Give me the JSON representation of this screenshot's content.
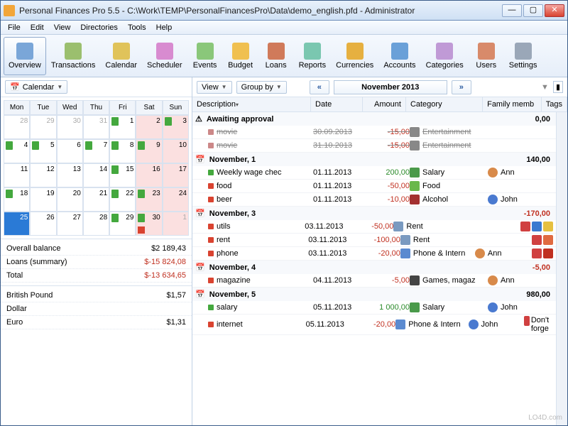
{
  "window": {
    "title": "Personal Finances Pro 5.5 - C:\\Work\\TEMP\\PersonalFinancesPro\\Data\\demo_english.pfd - Administrator"
  },
  "menu": [
    "File",
    "Edit",
    "View",
    "Directories",
    "Tools",
    "Help"
  ],
  "toolbar": [
    {
      "label": "Overview",
      "color": "#7aa6d8",
      "active": true
    },
    {
      "label": "Transactions",
      "color": "#9bbf6e"
    },
    {
      "label": "Calendar",
      "color": "#e0c35a"
    },
    {
      "label": "Scheduler",
      "color": "#d88bd0"
    },
    {
      "label": "Events",
      "color": "#8ac77a"
    },
    {
      "label": "Budget",
      "color": "#f0c050"
    },
    {
      "label": "Loans",
      "color": "#d07a5a"
    },
    {
      "label": "Reports",
      "color": "#7ac7b0"
    },
    {
      "label": "Currencies",
      "color": "#e6b040"
    },
    {
      "label": "Accounts",
      "color": "#6aa0d8"
    },
    {
      "label": "Categories",
      "color": "#c09ad6"
    },
    {
      "label": "Users",
      "color": "#d88a6a"
    },
    {
      "label": "Settings",
      "color": "#9aa7b8"
    }
  ],
  "left_toolbar": {
    "calendar": "Calendar"
  },
  "right_toolbar": {
    "view": "View",
    "group_by": "Group by",
    "month": "November 2013"
  },
  "days": [
    "Mon",
    "Tue",
    "Wed",
    "Thu",
    "Fri",
    "Sat",
    "Sun"
  ],
  "calendar_cells": [
    {
      "n": "28",
      "other": true
    },
    {
      "n": "29",
      "other": true
    },
    {
      "n": "30",
      "other": true
    },
    {
      "n": "31",
      "other": true
    },
    {
      "n": "1",
      "mark": true
    },
    {
      "n": "2",
      "wknd": true
    },
    {
      "n": "3",
      "wknd": true,
      "mark": true
    },
    {
      "n": "4",
      "mark": true
    },
    {
      "n": "5",
      "mark": true
    },
    {
      "n": "6"
    },
    {
      "n": "7",
      "mark": true
    },
    {
      "n": "8",
      "mark": true
    },
    {
      "n": "9",
      "wknd": true,
      "mark": true
    },
    {
      "n": "10",
      "wknd": true
    },
    {
      "n": "11"
    },
    {
      "n": "12"
    },
    {
      "n": "13"
    },
    {
      "n": "14"
    },
    {
      "n": "15",
      "mark": true
    },
    {
      "n": "16",
      "wknd": true
    },
    {
      "n": "17",
      "wknd": true
    },
    {
      "n": "18",
      "mark": true
    },
    {
      "n": "19"
    },
    {
      "n": "20"
    },
    {
      "n": "21"
    },
    {
      "n": "22",
      "mark": true
    },
    {
      "n": "23",
      "wknd": true,
      "mark": true
    },
    {
      "n": "24",
      "wknd": true
    },
    {
      "n": "25",
      "sel": true
    },
    {
      "n": "26"
    },
    {
      "n": "27"
    },
    {
      "n": "28"
    },
    {
      "n": "29",
      "mark": true
    },
    {
      "n": "30",
      "wknd": true,
      "mark": true,
      "note": true
    },
    {
      "n": "1",
      "wknd": true,
      "other": true
    }
  ],
  "summary": {
    "balance": {
      "label": "Overall balance",
      "value": "$2 189,43"
    },
    "loans": {
      "label": "Loans (summary)",
      "value": "$-15 824,08"
    },
    "total": {
      "label": "Total",
      "value": "$-13 634,65"
    }
  },
  "rates": [
    {
      "label": "British Pound",
      "value": "$1,57"
    },
    {
      "label": "Dollar",
      "value": ""
    },
    {
      "label": "Euro",
      "value": "$1,31"
    }
  ],
  "columns": {
    "desc": "Description",
    "date": "Date",
    "amount": "Amount",
    "category": "Category",
    "family": "Family memb",
    "tags": "Tags"
  },
  "groups": [
    {
      "title": "Awaiting approval",
      "amount": "0,00",
      "warn": true,
      "rows": [
        {
          "desc": "movie",
          "date": "30.09.2013",
          "amount": "-15,00",
          "neg": true,
          "cat": "Entertainment",
          "catc": "#888",
          "striked": true
        },
        {
          "desc": "movie",
          "date": "31.10.2013",
          "amount": "-15,00",
          "neg": true,
          "cat": "Entertainment",
          "catc": "#888",
          "striked": true
        }
      ]
    },
    {
      "title": "November, 1",
      "amount": "140,00",
      "rows": [
        {
          "desc": "Weekly wage chec",
          "date": "01.11.2013",
          "amount": "200,00",
          "pos": true,
          "cat": "Salary",
          "catc": "#4a9a4a",
          "fam": "Ann",
          "famc": "#d88a4a",
          "dot": "g"
        },
        {
          "desc": "food",
          "date": "01.11.2013",
          "amount": "-50,00",
          "neg": true,
          "cat": "Food",
          "catc": "#6ab84a",
          "dot": "r"
        },
        {
          "desc": "beer",
          "date": "01.11.2013",
          "amount": "-10,00",
          "neg": true,
          "cat": "Alcohol",
          "catc": "#a33030",
          "fam": "John",
          "famc": "#4a7ad0",
          "dot": "r"
        }
      ]
    },
    {
      "title": "November, 3",
      "amount": "-170,00",
      "neg": true,
      "rows": [
        {
          "desc": "utils",
          "date": "03.11.2013",
          "amount": "-50,00",
          "neg": true,
          "cat": "Rent",
          "catc": "#7a9ac0",
          "dot": "r",
          "tags": [
            "#d04040",
            "#3a7ad0",
            "#e6c040"
          ]
        },
        {
          "desc": "rent",
          "date": "03.11.2013",
          "amount": "-100,00",
          "neg": true,
          "cat": "Rent",
          "catc": "#7a9ac0",
          "dot": "r",
          "tags": [
            "#d04040",
            "#e06a40"
          ]
        },
        {
          "desc": "phone",
          "date": "03.11.2013",
          "amount": "-20,00",
          "neg": true,
          "cat": "Phone & Intern",
          "catc": "#5a8ad0",
          "fam": "Ann",
          "famc": "#d88a4a",
          "dot": "r",
          "tags": [
            "#d04040",
            "#c03020"
          ]
        }
      ]
    },
    {
      "title": "November, 4",
      "amount": "-5,00",
      "neg": true,
      "rows": [
        {
          "desc": "magazine",
          "date": "04.11.2013",
          "amount": "-5,00",
          "neg": true,
          "cat": "Games, magaz",
          "catc": "#444",
          "fam": "Ann",
          "famc": "#d88a4a",
          "dot": "r"
        }
      ]
    },
    {
      "title": "November, 5",
      "amount": "980,00",
      "rows": [
        {
          "desc": "salary",
          "date": "05.11.2013",
          "amount": "1 000,00",
          "pos": true,
          "cat": "Salary",
          "catc": "#4a9a4a",
          "fam": "John",
          "famc": "#4a7ad0",
          "dot": "g"
        },
        {
          "desc": "internet",
          "date": "05.11.2013",
          "amount": "-20,00",
          "neg": true,
          "cat": "Phone & Intern",
          "catc": "#5a8ad0",
          "fam": "John",
          "famc": "#4a7ad0",
          "dot": "r",
          "tags": [
            "#d04040"
          ],
          "tagtext": "Don't forge"
        }
      ]
    }
  ],
  "watermark": "LO4D.com"
}
